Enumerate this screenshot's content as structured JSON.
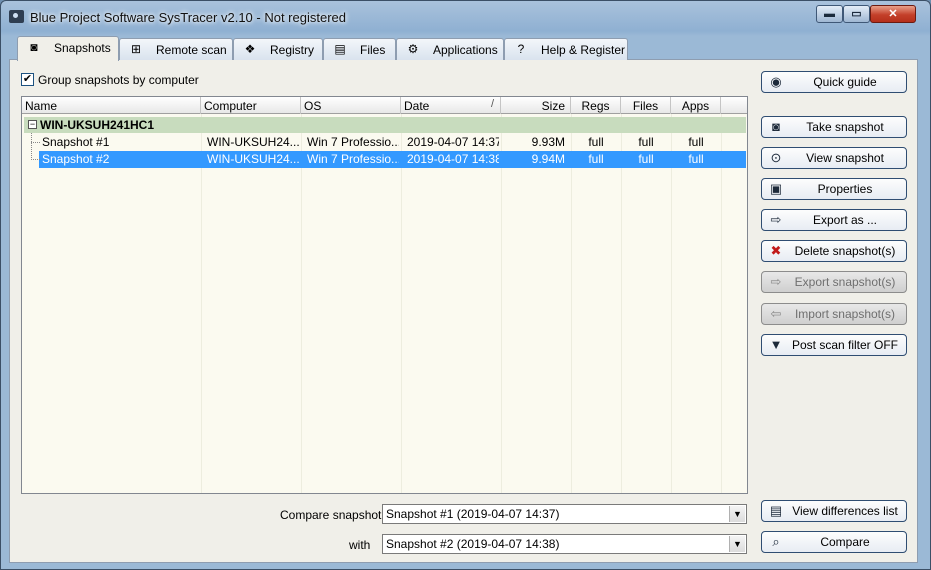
{
  "window": {
    "title": "Blue Project Software SysTracer v2.10 - Not registered"
  },
  "caption_buttons": {
    "minimize": "▬",
    "maximize": "▭",
    "close": "✕"
  },
  "tabs": [
    {
      "label": "Snapshots",
      "icon": "camera-icon",
      "active": true
    },
    {
      "label": "Remote scan",
      "icon": "network-icon",
      "active": false
    },
    {
      "label": "Registry",
      "icon": "registry-icon",
      "active": false
    },
    {
      "label": "Files",
      "icon": "files-icon",
      "active": false
    },
    {
      "label": "Applications",
      "icon": "applications-icon",
      "active": false
    },
    {
      "label": "Help & Register",
      "icon": "help-icon",
      "active": false
    }
  ],
  "group_checkbox": {
    "label": "Group snapshots by computer",
    "checked": "✔"
  },
  "list": {
    "columns": [
      "Name",
      "Computer",
      "OS",
      "Date",
      "Size",
      "Regs",
      "Files",
      "Apps"
    ],
    "sort_indicator": "/",
    "group": {
      "expander": "−",
      "name": "WIN-UKSUH241HC1"
    },
    "rows": [
      {
        "name": "Snapshot #1",
        "computer": "WIN-UKSUH24...",
        "os": "Win 7 Professio...",
        "date": "2019-04-07 14:37",
        "size": "9.93M",
        "regs": "full",
        "files": "full",
        "apps": "full",
        "selected": false
      },
      {
        "name": "Snapshot #2",
        "computer": "WIN-UKSUH24...",
        "os": "Win 7 Professio...",
        "date": "2019-04-07 14:38",
        "size": "9.94M",
        "regs": "full",
        "files": "full",
        "apps": "full",
        "selected": true
      }
    ]
  },
  "side_buttons": [
    {
      "label": "Quick guide",
      "icon": "guide-icon",
      "enabled": true
    },
    {
      "label": "Take snapshot",
      "icon": "camera-icon",
      "enabled": true
    },
    {
      "label": "View snapshot",
      "icon": "view-snapshot-icon",
      "enabled": true
    },
    {
      "label": "Properties",
      "icon": "properties-icon",
      "enabled": true
    },
    {
      "label": "Export as ...",
      "icon": "export-icon",
      "enabled": true
    },
    {
      "label": "Delete snapshot(s)",
      "icon": "delete-snapshot-icon",
      "enabled": true
    },
    {
      "label": "Export snapshot(s)",
      "icon": "export-snapshot-icon",
      "enabled": false
    },
    {
      "label": "Import snapshot(s)",
      "icon": "import-snapshot-icon",
      "enabled": false
    },
    {
      "label": "Post scan filter OFF",
      "icon": "filter-icon",
      "enabled": true
    },
    {
      "label": "View differences list",
      "icon": "differences-icon",
      "enabled": true
    },
    {
      "label": "Compare",
      "icon": "magnifier-icon",
      "enabled": true
    }
  ],
  "compare": {
    "label": "Compare snapshot",
    "value": "Snapshot #1 (2019-04-07 14:37)",
    "with_label": "with",
    "with_value": "Snapshot #2 (2019-04-07 14:38)",
    "dropdown_glyph": "▼"
  }
}
